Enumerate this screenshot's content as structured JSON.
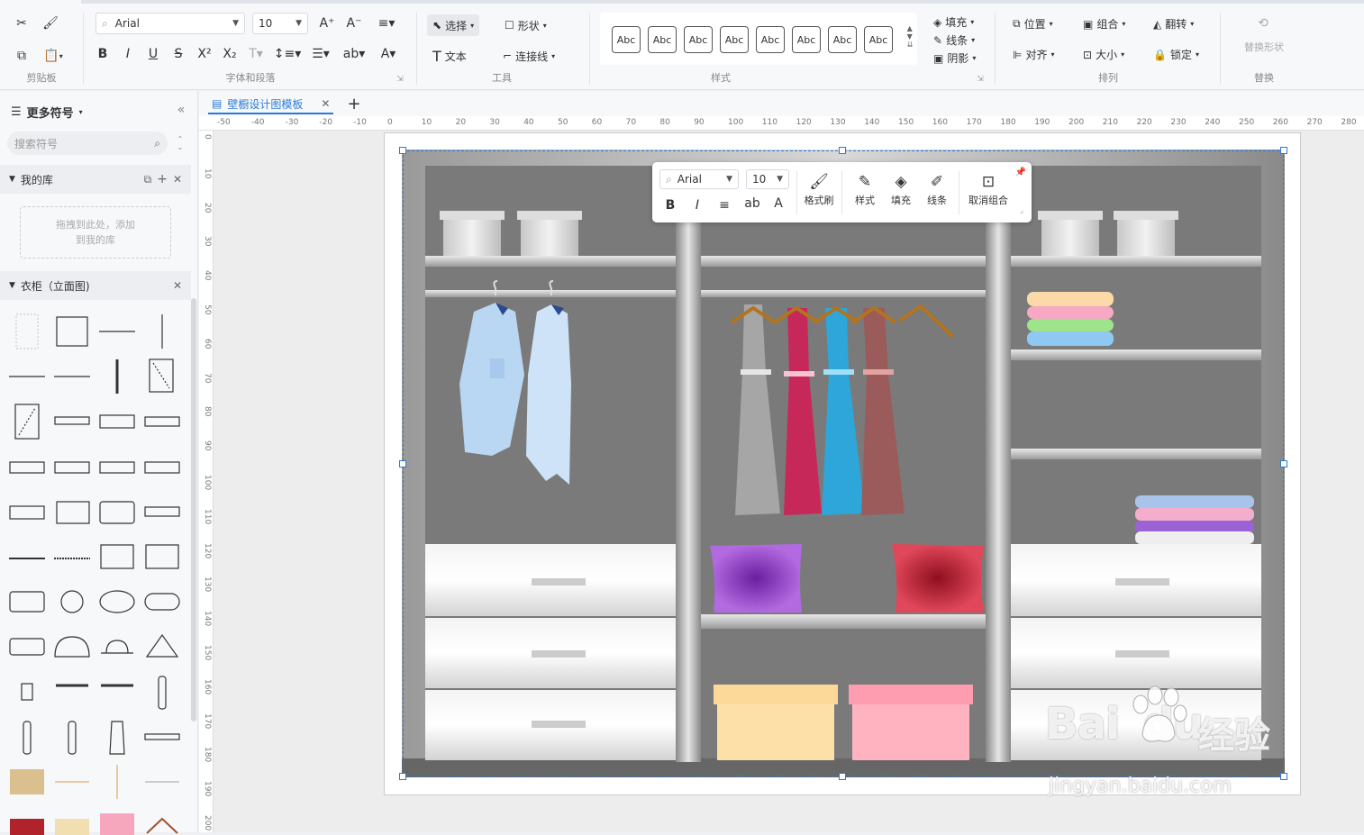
{
  "ribbon": {
    "clipboard": {
      "label": "剪贴板"
    },
    "font": {
      "family": "Arial",
      "size": "10",
      "label": "字体和段落"
    },
    "tools": {
      "select": "选择",
      "shape": "形状",
      "text": "文本",
      "connector": "连接线",
      "label": "工具"
    },
    "styles": {
      "box_text": "Abc",
      "label": "样式"
    },
    "fill": "填充",
    "line": "线条",
    "shadow": "阴影",
    "arrange": {
      "position": "位置",
      "group": "组合",
      "flip": "翻转",
      "align": "对齐",
      "size": "大小",
      "lock": "锁定",
      "label": "排列"
    },
    "replace": {
      "shape": "替换形状",
      "label": "替换"
    }
  },
  "sidebar": {
    "title": "更多符号",
    "search_placeholder": "搜索符号",
    "my_library": "我的库",
    "drop_hint": "拖拽到此处，添加到我的库",
    "category": "衣柜（立面图)"
  },
  "tab": {
    "title": "壁橱设计图模板"
  },
  "ruler": {
    "h": [
      "-50",
      "-40",
      "-30",
      "-20",
      "-10",
      "0",
      "10",
      "20",
      "30",
      "40",
      "50",
      "60",
      "70",
      "80",
      "90",
      "100",
      "110",
      "120",
      "130",
      "140",
      "150",
      "160",
      "170",
      "180",
      "190",
      "200",
      "210",
      "220",
      "230",
      "240",
      "250",
      "260",
      "270",
      "280"
    ],
    "v": [
      "0",
      "10",
      "20",
      "30",
      "40",
      "50",
      "60",
      "70",
      "80",
      "90",
      "100",
      "110",
      "120",
      "130",
      "140",
      "150",
      "160",
      "170",
      "180",
      "190",
      "200"
    ]
  },
  "floating_toolbar": {
    "font": "Arial",
    "size": "10",
    "format_painter": "格式刷",
    "style": "样式",
    "fill": "填充",
    "line": "线条",
    "ungroup": "取消组合"
  },
  "watermark": {
    "brand": "Bai",
    "brand2": "du",
    "cn": "经验",
    "url": "jingyan.baidu.com"
  },
  "colors": {
    "accent": "#2b7bd6",
    "wardrobe": "#7a7a7a"
  }
}
